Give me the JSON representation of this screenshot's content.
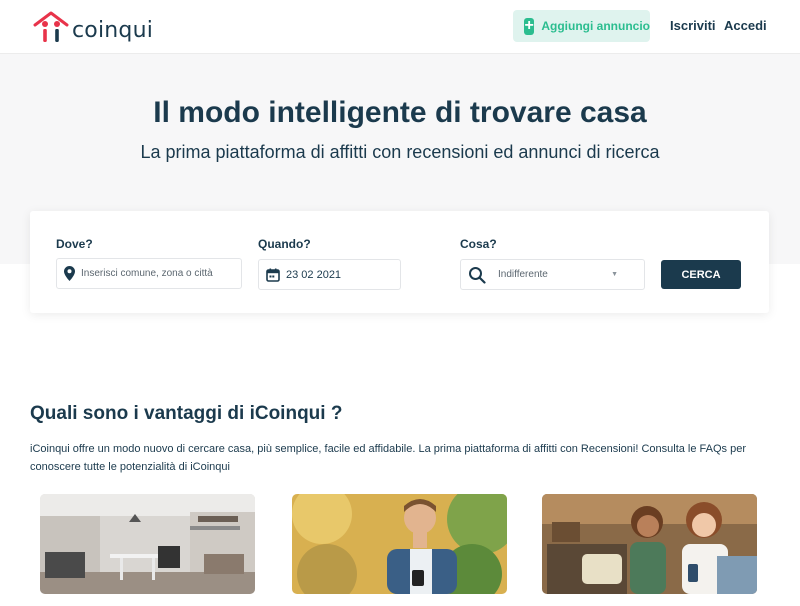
{
  "header": {
    "logo_text": "coinqui",
    "logo_letter": "i",
    "add_listing_label": "Aggiungi annuncio",
    "signup_label": "Iscriviti",
    "login_label": "Accedi"
  },
  "hero": {
    "title": "Il modo intelligente di trovare casa",
    "subtitle": "La prima piattaforma di affitti con recensioni ed annunci di ricerca"
  },
  "search": {
    "where_label": "Dove?",
    "where_placeholder": "Inserisci comune, zona o città",
    "when_label": "Quando?",
    "when_value": "23 02 2021",
    "what_label": "Cosa?",
    "what_value": "Indifferente",
    "button_label": "CERCA"
  },
  "benefits": {
    "title": "Quali sono i vantaggi di iCoinqui ?",
    "text": "iCoinqui offre un modo nuovo di cercare casa, più semplice, facile ed affidabile. La prima piattaforma di affitti con Recensioni! Consulta le FAQs per conoscere tutte le potenzialità di iCoinqui"
  },
  "icons": {
    "logo": "house-people-logo",
    "add": "plus-icon",
    "where": "map-pin-icon",
    "when": "calendar-icon",
    "what": "search-icon",
    "dropdown": "chevron-down-icon"
  },
  "colors": {
    "brand_dark": "#1b3a4d",
    "accent_green": "#2bbd8f",
    "accent_green_bg": "#dff3ee",
    "logo_red": "#e8334a",
    "hero_bg": "#f7f7f8"
  }
}
